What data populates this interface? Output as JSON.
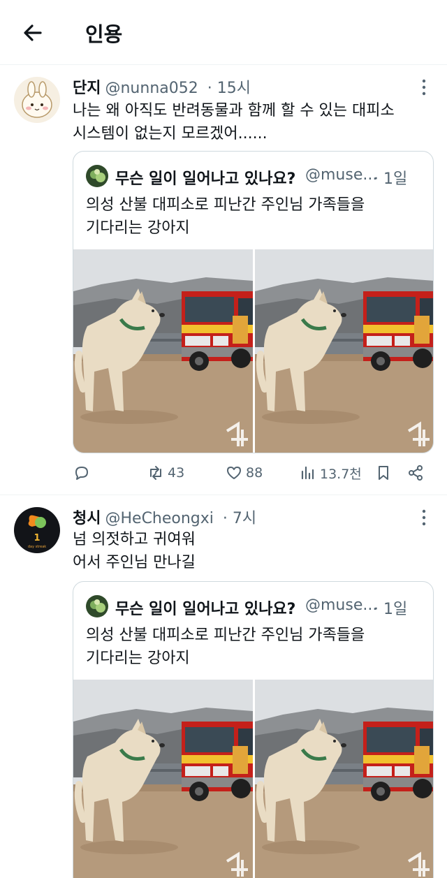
{
  "header": {
    "title": "인용",
    "back_icon": "arrow-left-icon"
  },
  "tweets": [
    {
      "name": "단지",
      "handle": "@nunna052",
      "time": "· 15시",
      "text_lines": [
        "나는 왜 아직도 반려동물과 함께 할 수 있는 대피소",
        "시스템이 없는지 모르겠어......"
      ],
      "quote": {
        "name": "무슨 일이 일어나고 있나요?",
        "handle": "@muse...",
        "time": "· 1일",
        "text_lines": [
          "의성 산불 대피소로 피난간 주인님 가족들을",
          "기다리는 강아지"
        ],
        "watermark": "뉴"
      },
      "stats": {
        "retweets": "43",
        "likes": "88",
        "views": "13.7천"
      }
    },
    {
      "name": "청시",
      "handle": "@HeCheongxi",
      "time": "· 7시",
      "avatar_badge_number": "1",
      "avatar_badge_text": "day streak",
      "text_lines": [
        "넘 의젓하고 귀여워",
        "어서 주인님 만나길"
      ],
      "quote": {
        "name": "무슨 일이 일어나고 있나요?",
        "handle": "@muse...",
        "time": "· 1일",
        "text_lines": [
          "의성 산불 대피소로 피난간 주인님 가족들을",
          "기다리는 강아지"
        ],
        "watermark": "뉴"
      }
    }
  ],
  "colors": {
    "text": "#0f1419",
    "secondary": "#536471",
    "border": "#cfd9de",
    "firetruck": "#c4201a"
  }
}
